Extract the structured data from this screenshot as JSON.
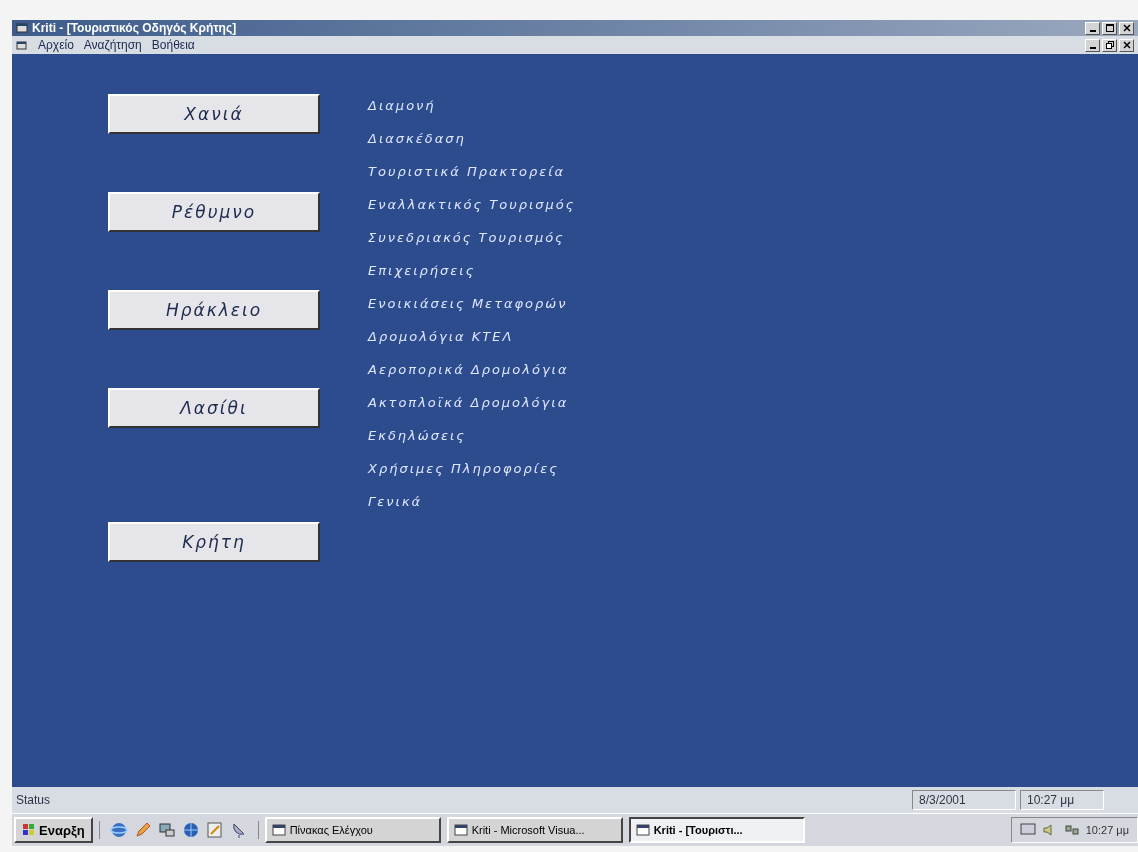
{
  "window": {
    "title": "Kriti - [Τουριστικός Οδηγός Κρήτης]"
  },
  "menu": [
    "Αρχείο",
    "Αναζήτηση",
    "Βοήθεια"
  ],
  "region_buttons": [
    "Χανιά",
    "Ρέθυμνο",
    "Ηράκλειο",
    "Λασίθι",
    "Κρήτη"
  ],
  "categories": [
    "Διαμονή",
    "Διασκέδαση",
    "Τουριστικά Πρακτορεία",
    "Εναλλακτικός Τουρισμός",
    "Συνεδριακός Τουρισμός",
    "Επιχειρήσεις",
    "Ενοικιάσεις Μεταφορών",
    "Δρομολόγια ΚΤΕΛ",
    "Αεροπορικά Δρομολόγια",
    "Ακτοπλοϊκά Δρομολόγια",
    "Εκδηλώσεις",
    "Χρήσιμες Πληροφορίες",
    "Γενικά"
  ],
  "status_bar": {
    "status": "Status",
    "date": "8/3/2001",
    "time": "10:27 μμ"
  },
  "taskbar": {
    "start": "Εναρξη",
    "tasks": [
      {
        "label": "Πίνακας Ελέγχου",
        "selected": false
      },
      {
        "label": "Kriti - Microsoft Visua...",
        "selected": false
      },
      {
        "label": "Kriti - [Τουριστι...",
        "selected": true
      }
    ],
    "clock": "10:27 μμ"
  }
}
